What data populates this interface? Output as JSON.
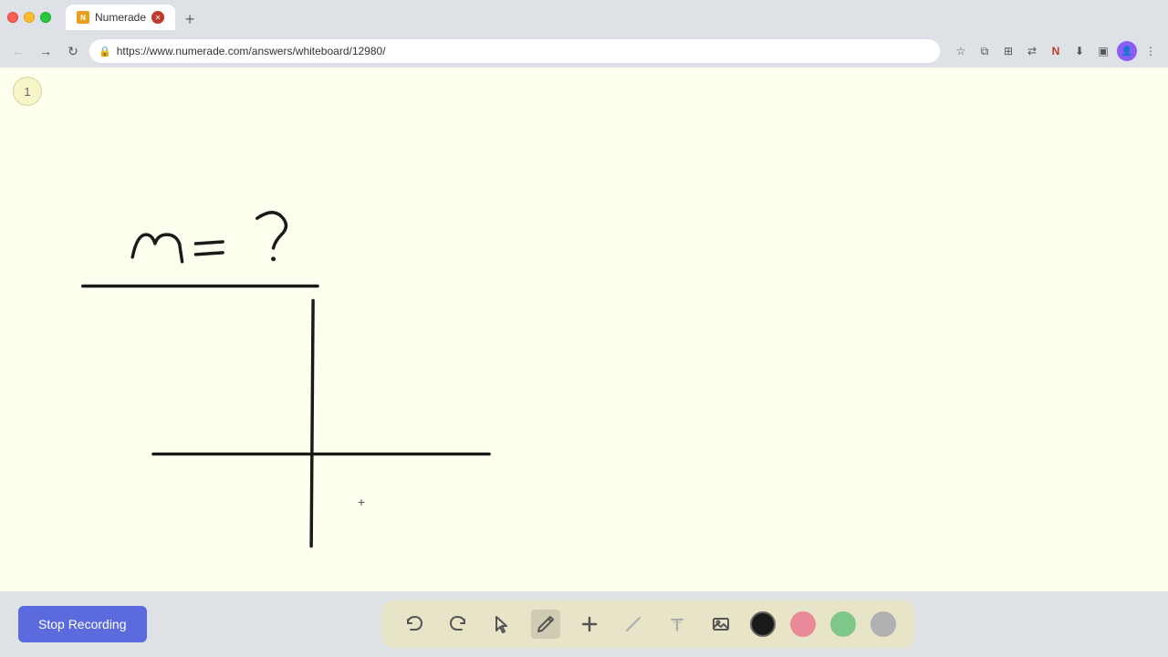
{
  "browser": {
    "tab_title": "Numerade",
    "tab_url": "https://www.numerade.com/answers/whiteboard/12980/",
    "favicon_text": "N",
    "new_tab_symbol": "+"
  },
  "address_bar": {
    "url": "https://www.numerade.com/answers/whiteboard/12980/",
    "lock_icon": "🔒"
  },
  "page": {
    "page_number": "1",
    "bg_color": "#fffff0"
  },
  "whiteboard": {
    "equation_text": "m = ?",
    "cursor_symbol": "+"
  },
  "toolbar": {
    "stop_recording_label": "Stop Recording",
    "tools": [
      {
        "name": "undo",
        "symbol": "↩",
        "label": "Undo"
      },
      {
        "name": "redo",
        "symbol": "↪",
        "label": "Redo"
      },
      {
        "name": "select",
        "symbol": "▲",
        "label": "Select"
      },
      {
        "name": "pen",
        "symbol": "✏",
        "label": "Pen"
      },
      {
        "name": "add",
        "symbol": "+",
        "label": "Add"
      },
      {
        "name": "eraser",
        "symbol": "/",
        "label": "Eraser"
      },
      {
        "name": "text",
        "symbol": "T",
        "label": "Text"
      },
      {
        "name": "image",
        "symbol": "▣",
        "label": "Image"
      }
    ],
    "colors": [
      {
        "name": "black",
        "value": "#1a1a1a",
        "active": true
      },
      {
        "name": "pink",
        "value": "#e88a9a"
      },
      {
        "name": "green",
        "value": "#7ec88a"
      },
      {
        "name": "gray",
        "value": "#b0b0b0"
      }
    ]
  }
}
